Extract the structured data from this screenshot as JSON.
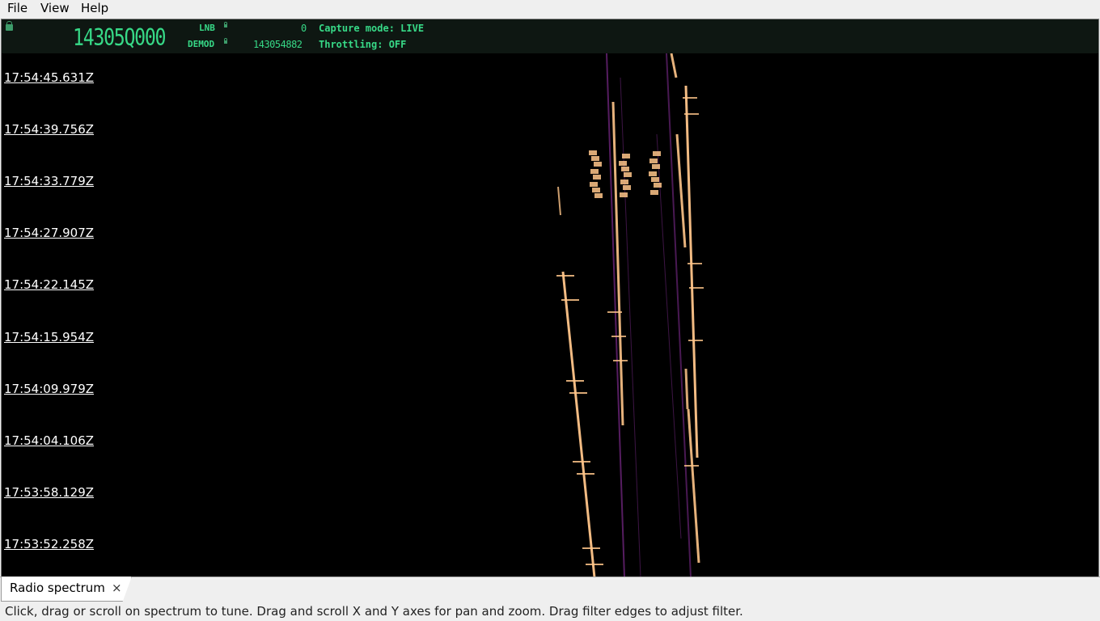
{
  "menu": {
    "file": "File",
    "view": "View",
    "help": "Help"
  },
  "header": {
    "main_frequency": "14305Q000",
    "lnb_label": "LNB",
    "lnb_value": "0",
    "demod_label": "DEMOD",
    "demod_value": "143054882",
    "capture_mode": "Capture mode: LIVE",
    "throttling": "Throttling: OFF",
    "lcd_color": "#37d987"
  },
  "waterfall": {
    "time_labels": [
      "17:54:45.631Z",
      "17:54:39.756Z",
      "17:54:33.779Z",
      "17:54:27.907Z",
      "17:54:22.145Z",
      "17:54:15.954Z",
      "17:54:09.979Z",
      "17:54:04.106Z",
      "17:53:58.129Z",
      "17:53:52.258Z"
    ],
    "signal_color": "#ffc58a",
    "noise_color": "#7a2a8a"
  },
  "tabs": [
    {
      "label": "Radio spectrum",
      "close": "×"
    }
  ],
  "status_text": "Click, drag or scroll on spectrum to tune. Drag and scroll X and Y axes for pan and zoom. Drag filter edges to adjust filter."
}
